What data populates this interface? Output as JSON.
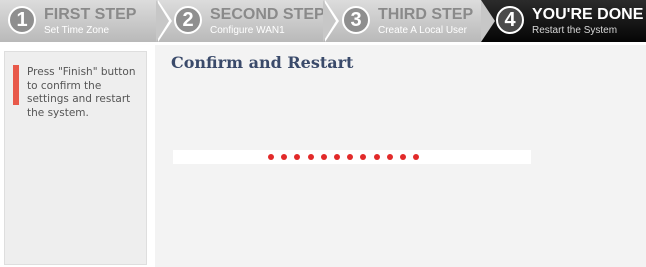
{
  "wizard": {
    "steps": [
      {
        "number": "1",
        "title": "FIRST STEP",
        "subtitle": "Set Time Zone",
        "state": "inactive"
      },
      {
        "number": "2",
        "title": "SECOND STEP",
        "subtitle": "Configure WAN1",
        "state": "inactive"
      },
      {
        "number": "3",
        "title": "THIRD STEP",
        "subtitle": "Create A Local User",
        "state": "inactive"
      },
      {
        "number": "4",
        "title": "YOU'RE DONE",
        "subtitle": "Restart the System",
        "state": "active"
      }
    ]
  },
  "sidebar": {
    "help_text": "Press \"Finish\" button to confirm the settings and restart the system.",
    "accent_color": "#e8594a"
  },
  "main": {
    "heading": "Confirm and Restart",
    "progress": {
      "dot_count": 12,
      "dot_color": "#e22a2a"
    }
  },
  "colors": {
    "active_step_bg": "#050505",
    "inactive_step_bg": "#c7c7c7"
  }
}
